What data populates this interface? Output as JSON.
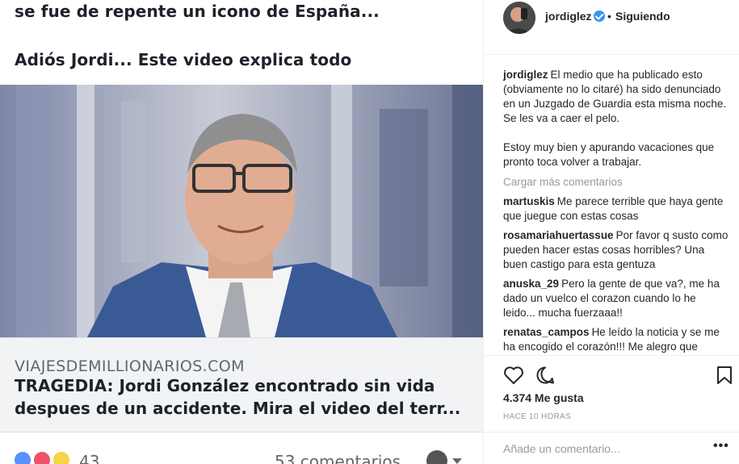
{
  "post_image": {
    "headline_line1": "se fue de repente un icono de España...",
    "headline_line2": "Adiós Jordi... Este video explica todo",
    "link": {
      "domain": "VIAJESDEMILLIONARIOS.COM",
      "title_line1": "TRAGEDIA: Jordi González encontrado sin vida",
      "title_line2": "despues de un accidente.  Mira el video del terr..."
    },
    "reactions": {
      "count": "43",
      "icons": [
        "like-icon",
        "angry-icon",
        "wow-icon"
      ]
    },
    "comments_count": "53 comentarios"
  },
  "header": {
    "username": "jordiglez",
    "separator": "•",
    "follow_status": "Siguiendo"
  },
  "caption": {
    "username": "jordiglez",
    "paragraph1": "El medio que ha publicado esto (obviamente no lo citaré) ha sido denunciado en un Juzgado de Guardia esta misma noche. Se les va a caer el pelo.",
    "paragraph2": "Estoy muy bien y apurando vacaciones que pronto toca volver a trabajar."
  },
  "load_more": "Cargar más comentarios",
  "comments": [
    {
      "username": "martuskis",
      "text": "Me parece terrible que haya gente que juegue con estas cosas"
    },
    {
      "username": "rosamariahuertassue",
      "text": "Por favor q susto como pueden hacer estas cosas horribles? Una buen castigo para esta gentuza"
    },
    {
      "username": "anuska_29",
      "text": "Pero la gente de que va?, me ha dado un vuelco el corazon cuando lo he leido... mucha fuerzaaa!!"
    },
    {
      "username": "renatas_campos",
      "text": "He leído la noticia y se me ha encogido el corazón!!! Me alegro que"
    }
  ],
  "likes": "4.374 Me gusta",
  "time_ago": "HACE 10 HORAS",
  "add_comment": {
    "placeholder": "Añade un comentario...",
    "more": "•••"
  },
  "colors": {
    "accent": "#3897f0",
    "fb_text": "#1d2129",
    "fb_meta": "#606770"
  }
}
